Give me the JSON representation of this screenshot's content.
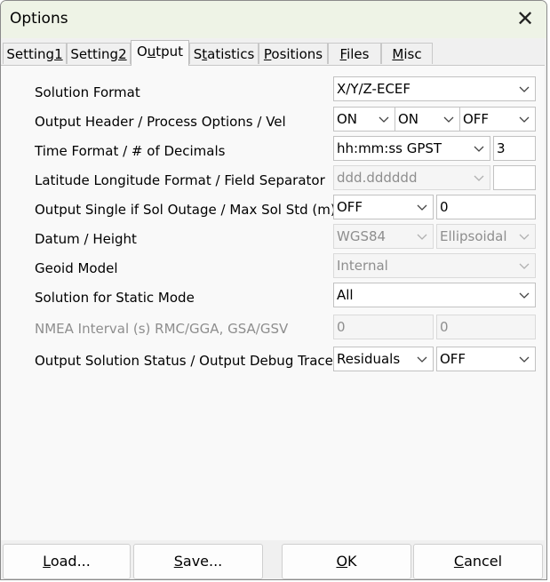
{
  "window": {
    "title": "Options"
  },
  "tabs": [
    {
      "pre": "Setting",
      "ul": "1",
      "post": ""
    },
    {
      "pre": "Setting",
      "ul": "2",
      "post": ""
    },
    {
      "pre": "O",
      "ul": "u",
      "post": "tput"
    },
    {
      "pre": "S",
      "ul": "t",
      "post": "atistics"
    },
    {
      "pre": "",
      "ul": "P",
      "post": "ositions"
    },
    {
      "pre": "",
      "ul": "F",
      "post": "iles"
    },
    {
      "pre": "",
      "ul": "M",
      "post": "isc"
    }
  ],
  "active_tab": "Output",
  "rows": {
    "solution_format": {
      "label": "Solution Format",
      "value": "X/Y/Z-ECEF"
    },
    "output_header": {
      "label": "Output Header / Process Options / Vel",
      "header": "ON",
      "process": "ON",
      "vel": "OFF"
    },
    "time_format": {
      "label": "Time Format / # of Decimals",
      "value": "hh:mm:ss GPST",
      "decimals": "3"
    },
    "latlon_format": {
      "label": "Latitude Longitude Format / Field Separator",
      "value": "ddd.dddddd",
      "separator": ""
    },
    "sol_outage": {
      "label": "Output Single if Sol Outage / Max Sol Std (m)",
      "value": "OFF",
      "max_std": "0"
    },
    "datum_height": {
      "label": "Datum / Height",
      "datum": "WGS84",
      "height": "Ellipsoidal"
    },
    "geoid_model": {
      "label": "Geoid Model",
      "value": "Internal"
    },
    "static_mode": {
      "label": "Solution for Static Mode",
      "value": "All"
    },
    "nmea_interval": {
      "label": "NMEA Interval (s) RMC/GGA, GSA/GSV",
      "rmc_gga": "0",
      "gsa_gsv": "0"
    },
    "output_status": {
      "label": "Output Solution Status / Output Debug Trace",
      "status": "Residuals",
      "trace": "OFF"
    }
  },
  "buttons": {
    "load": {
      "ul": "L",
      "rest": "oad..."
    },
    "save": {
      "ul": "S",
      "rest": "ave..."
    },
    "ok": {
      "ul": "O",
      "rest": "K"
    },
    "cancel": {
      "ul": "C",
      "rest": "ancel"
    }
  },
  "icons": {
    "close": "close-icon",
    "dropdown": "chevron-down-icon"
  }
}
